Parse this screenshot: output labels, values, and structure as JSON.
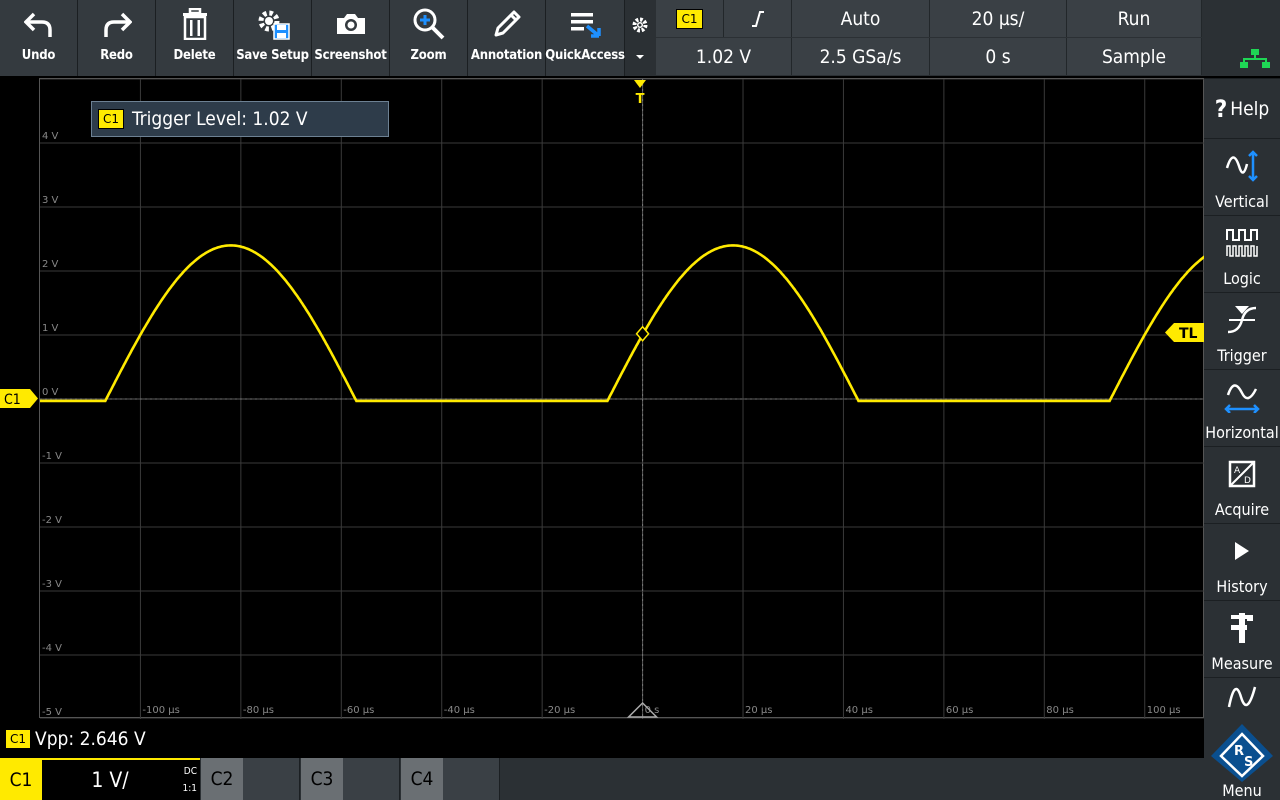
{
  "toolbar": {
    "undo": "Undo",
    "redo": "Redo",
    "delete": "Delete",
    "save_setup": "Save Setup",
    "screenshot": "Screenshot",
    "zoom": "Zoom",
    "annotation": "Annotation",
    "quickaccess": "QuickAccess"
  },
  "indicators": {
    "trigger_source": "C1",
    "trigger_slope": "⨍",
    "trigger_mode": "Auto",
    "timebase": "20 µs/",
    "run_state": "Run",
    "trigger_level": "1.02 V",
    "sample_rate": "2.5 GSa/s",
    "horizontal_position": "0 s",
    "acquire_mode": "Sample"
  },
  "sidebar": {
    "help": "Help",
    "vertical": "Vertical",
    "logic": "Logic",
    "trigger": "Trigger",
    "horizontal": "Horizontal",
    "acquire": "Acquire",
    "history": "History",
    "measure": "Measure",
    "menu": "Menu"
  },
  "plot": {
    "popup_tag": "C1",
    "popup_text": "Trigger Level: 1.02 V",
    "c1_marker": "C1",
    "tl_marker": "TL",
    "trigger_top": "T"
  },
  "measurement": {
    "tag": "C1",
    "text": "Vpp: 2.646 V"
  },
  "channels": {
    "c1": {
      "name": "C1",
      "scale": "1 V/",
      "coupling": "DC",
      "probe": "1:1"
    },
    "c2": {
      "name": "C2"
    },
    "c3": {
      "name": "C3"
    },
    "c4": {
      "name": "C4"
    }
  },
  "colors": {
    "trace": "#ffea00",
    "grid": "#3a3a3a",
    "axis": "#5a5a5a",
    "accent_blue": "#1e90ff"
  },
  "chart_data": {
    "type": "line",
    "title": "",
    "xlabel": "",
    "ylabel": "",
    "y_tick_labels": [
      "4 V",
      "3 V",
      "2 V",
      "1 V",
      "0 V",
      "-1 V",
      "-2 V",
      "-3 V",
      "-4 V",
      "-5 V"
    ],
    "x_tick_labels": [
      "-100 µs",
      "-80 µs",
      "-60 µs",
      "-40 µs",
      "-20 µs",
      "0 s",
      "20 µs",
      "40 µs",
      "60 µs",
      "80 µs",
      "100 µs"
    ],
    "x_tick_values": [
      -100,
      -80,
      -60,
      -40,
      -20,
      0,
      20,
      40,
      60,
      80,
      100
    ],
    "y_tick_values": [
      4,
      3,
      2,
      1,
      0,
      -1,
      -2,
      -3,
      -4,
      -5
    ],
    "xlim": [
      -120,
      112
    ],
    "ylim": [
      -5,
      5
    ],
    "x_unit": "µs",
    "y_unit": "V",
    "grid": true,
    "series": [
      {
        "x": [
          -120,
          -107,
          -100,
          -95,
          -90,
          -85,
          -81.4,
          -78,
          -74,
          -70,
          -65,
          -57,
          -54,
          -50,
          -40,
          -30,
          -20,
          -7,
          0,
          5,
          10,
          15,
          18.6,
          22,
          26,
          30,
          35,
          43,
          50,
          60,
          70,
          80,
          93,
          100,
          105,
          112
        ],
        "y": [
          -0.03,
          -0.03,
          0.97,
          1.6,
          2.05,
          2.32,
          2.4,
          2.34,
          2.1,
          1.7,
          0.97,
          -0.03,
          -0.03,
          -0.03,
          -0.03,
          -0.03,
          -0.03,
          -0.03,
          1.02,
          1.6,
          2.05,
          2.32,
          2.4,
          2.34,
          2.1,
          1.7,
          0.97,
          -0.03,
          -0.03,
          -0.03,
          -0.03,
          -0.03,
          -0.03,
          0.97,
          1.6,
          2.3
        ]
      }
    ],
    "trigger_level_v": 1.02,
    "vpp_v": 2.646
  }
}
